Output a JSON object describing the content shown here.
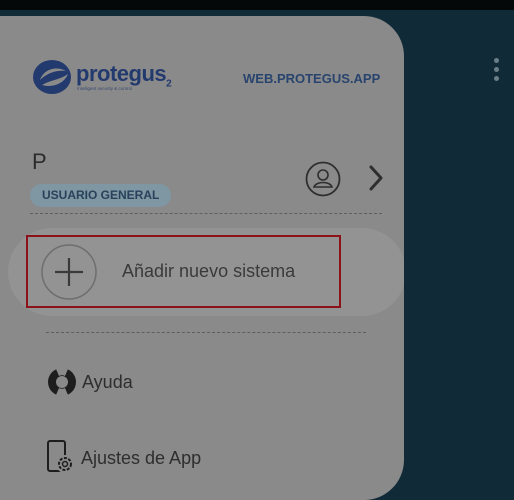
{
  "brand": {
    "name": "protegus",
    "superscript": "2",
    "tagline": "Intelligent security & control",
    "web_link": "WEB.PROTEGUS.APP"
  },
  "user": {
    "initial": "P",
    "role": "USUARIO GENERAL"
  },
  "actions": {
    "add_system": "Añadir nuevo sistema"
  },
  "menu": {
    "items": [
      {
        "label": "Ayuda",
        "icon": "lifebuoy-icon"
      },
      {
        "label": "Ajustes de App",
        "icon": "phone-settings-icon"
      }
    ]
  },
  "colors": {
    "brand_blue": "#233a6e",
    "highlight_border": "#8c1118",
    "backdrop": "#102a37"
  }
}
